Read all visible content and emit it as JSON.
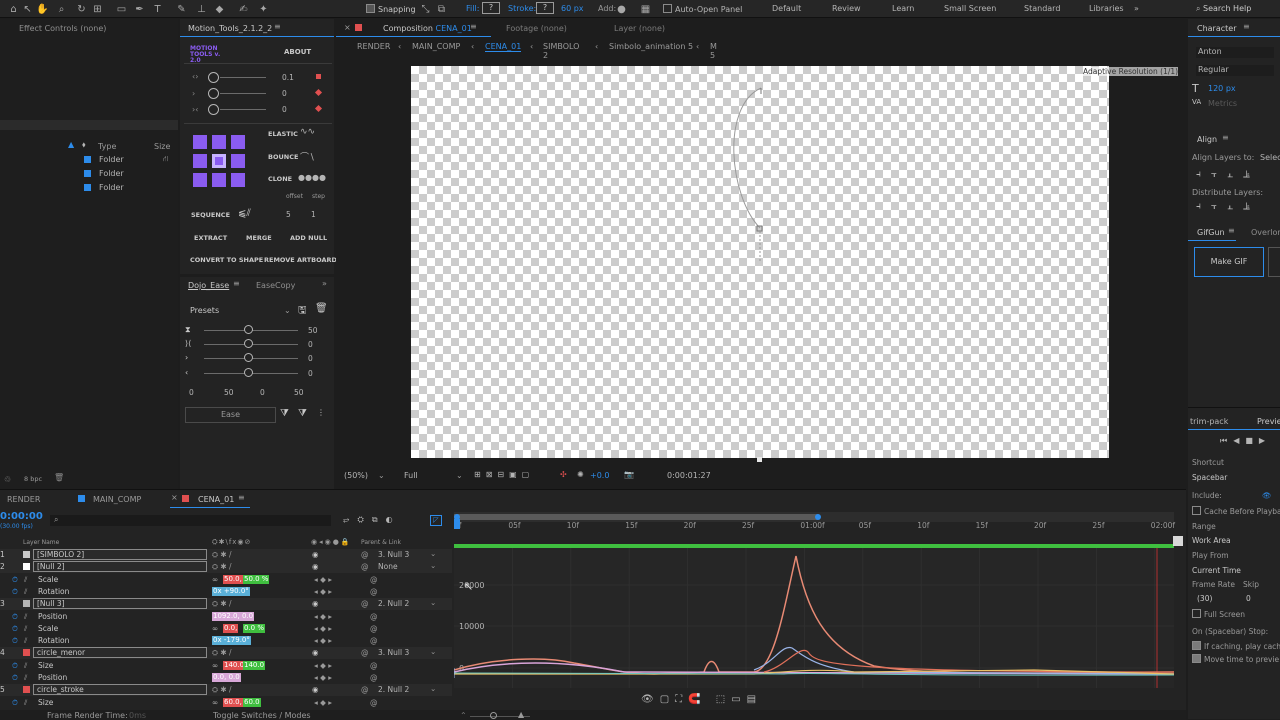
{
  "toolbar": {
    "snapping": "Snapping",
    "fill": "Fill:",
    "stroke": "Stroke:",
    "stroke_px": "60 px",
    "add": "Add:",
    "auto_open": "Auto-Open Panel",
    "workspaces": [
      "Default",
      "Review",
      "Learn",
      "Small Screen",
      "Standard",
      "Libraries"
    ],
    "search_help": "Search Help"
  },
  "effect_controls": {
    "title": "Effect Controls (none)",
    "cols": {
      "type": "Type",
      "size": "Size"
    },
    "folders": [
      "Folder",
      "Folder",
      "Folder"
    ],
    "footer_bpc": "8 bpc"
  },
  "motion_tools": {
    "tab": "Motion_Tools_2.1.2_2",
    "logo": "MOTION TOOLS v. 2.0",
    "about": "ABOUT",
    "sliders": [
      "0.1",
      "0",
      "0"
    ],
    "elastic": "ELASTIC",
    "bounce": "BOUNCE",
    "clone": "CLONE",
    "offset": "offset",
    "step": "step",
    "sequence": "SEQUENCE",
    "seq_offset": "5",
    "seq_step": "1",
    "extract": "EXTRACT",
    "merge": "MERGE",
    "add_null": "ADD NULL",
    "convert": "CONVERT TO SHAPE",
    "remove_artboard": "REMOVE ARTBOARD"
  },
  "dojo": {
    "tab": "Dojo_Ease",
    "tab2": "EaseCopy",
    "presets": "Presets",
    "rows": [
      "50",
      "0",
      "0",
      "0"
    ],
    "bottom": [
      "0",
      "50",
      "0",
      "50"
    ],
    "ease": "Ease"
  },
  "composition": {
    "tab": "Composition",
    "comp_name": "CENA_01",
    "footage": "Footage (none)",
    "layer": "Layer (none)",
    "breadcrumbs": [
      "RENDER",
      "MAIN_COMP",
      "CENA_01",
      "SIMBOLO 2",
      "Simbolo_animation 5",
      "M 5"
    ],
    "adaptive": "Adaptive Resolution (1/1)",
    "zoom": "(50%)",
    "quality": "Full",
    "exposure": "+0.0",
    "timecode": "0:00:01:27"
  },
  "right_panel": {
    "character": "Character",
    "font": "Anton",
    "style": "Regular",
    "size_px": "120 px",
    "metrics": "Metrics",
    "align": "Align",
    "align_to": "Align Layers to:",
    "align_to_val": "Selec",
    "distribute": "Distribute Layers:",
    "gifgun": "GifGun",
    "overlord": "Overlord",
    "make_gif": "Make GIF",
    "trim_pack": "trim-pack",
    "preview": "Previe",
    "shortcut": "Shortcut",
    "shortcut_val": "Spacebar",
    "include": "Include:",
    "cache_before": "Cache Before Playba",
    "range": "Range",
    "range_val": "Work Area",
    "play_from": "Play From",
    "play_from_val": "Current Time",
    "frame_rate": "Frame Rate",
    "skip": "Skip",
    "fr_val": "(30)",
    "skip_val": "0",
    "full_screen": "Full Screen",
    "on_stop": "On (Spacebar) Stop:",
    "if_caching": "If caching, play cache",
    "move_time": "Move time to previe"
  },
  "timeline": {
    "tabs": [
      "RENDER",
      "MAIN_COMP",
      "CENA_01"
    ],
    "timecode": "0:00:00",
    "fps": "(30.00 fps)",
    "col_layer": "Layer Name",
    "col_parent": "Parent & Link",
    "ruler": [
      "0f",
      "05f",
      "10f",
      "15f",
      "20f",
      "25f",
      "01:00f",
      "05f",
      "10f",
      "15f",
      "20f",
      "25f",
      "02:00f"
    ],
    "graph_labels": [
      "20000",
      "10000",
      "0"
    ],
    "footer_left": "Frame Render Time:",
    "footer_ms": "0ms",
    "footer_toggle": "Toggle Switches / Modes",
    "rows": [
      {
        "num": "1",
        "name": "[SIMBOLO 2]",
        "parent": "3. Null 3",
        "type": "layer"
      },
      {
        "num": "2",
        "name": "[Null 2]",
        "parent": "None",
        "type": "layer"
      },
      {
        "num": "",
        "name": "Scale",
        "val1": "50.0,",
        "val2": "50.0 %",
        "type": "prop"
      },
      {
        "num": "",
        "name": "Rotation",
        "val1": "0x +90.0°",
        "type": "prop"
      },
      {
        "num": "3",
        "name": "[Null 3]",
        "parent": "2. Null 2",
        "type": "layer"
      },
      {
        "num": "",
        "name": "Position",
        "val1": "1092.0, 0.0",
        "type": "prop"
      },
      {
        "num": "",
        "name": "Scale",
        "val1": "0.0,",
        "val2": "0.0 %",
        "type": "prop"
      },
      {
        "num": "",
        "name": "Rotation",
        "val1": "0x -179.0°",
        "type": "prop"
      },
      {
        "num": "4",
        "name": "circle_menor",
        "parent": "3. Null 3",
        "type": "layer"
      },
      {
        "num": "",
        "name": "Size",
        "val1": "140.0,",
        "val2": "140.0",
        "type": "prop"
      },
      {
        "num": "",
        "name": "Position",
        "val1": "0.0, 0.0",
        "type": "prop"
      },
      {
        "num": "5",
        "name": "circle_stroke",
        "parent": "2. Null 2",
        "type": "layer"
      },
      {
        "num": "",
        "name": "Size",
        "val1": "60.0,",
        "val2": "60.0",
        "type": "prop"
      }
    ]
  },
  "colors": {
    "accent": "#2d8ceb",
    "purple": "#8a5cf0",
    "pink_curve": "#e88a74",
    "green_bar": "#3fbf3f"
  }
}
